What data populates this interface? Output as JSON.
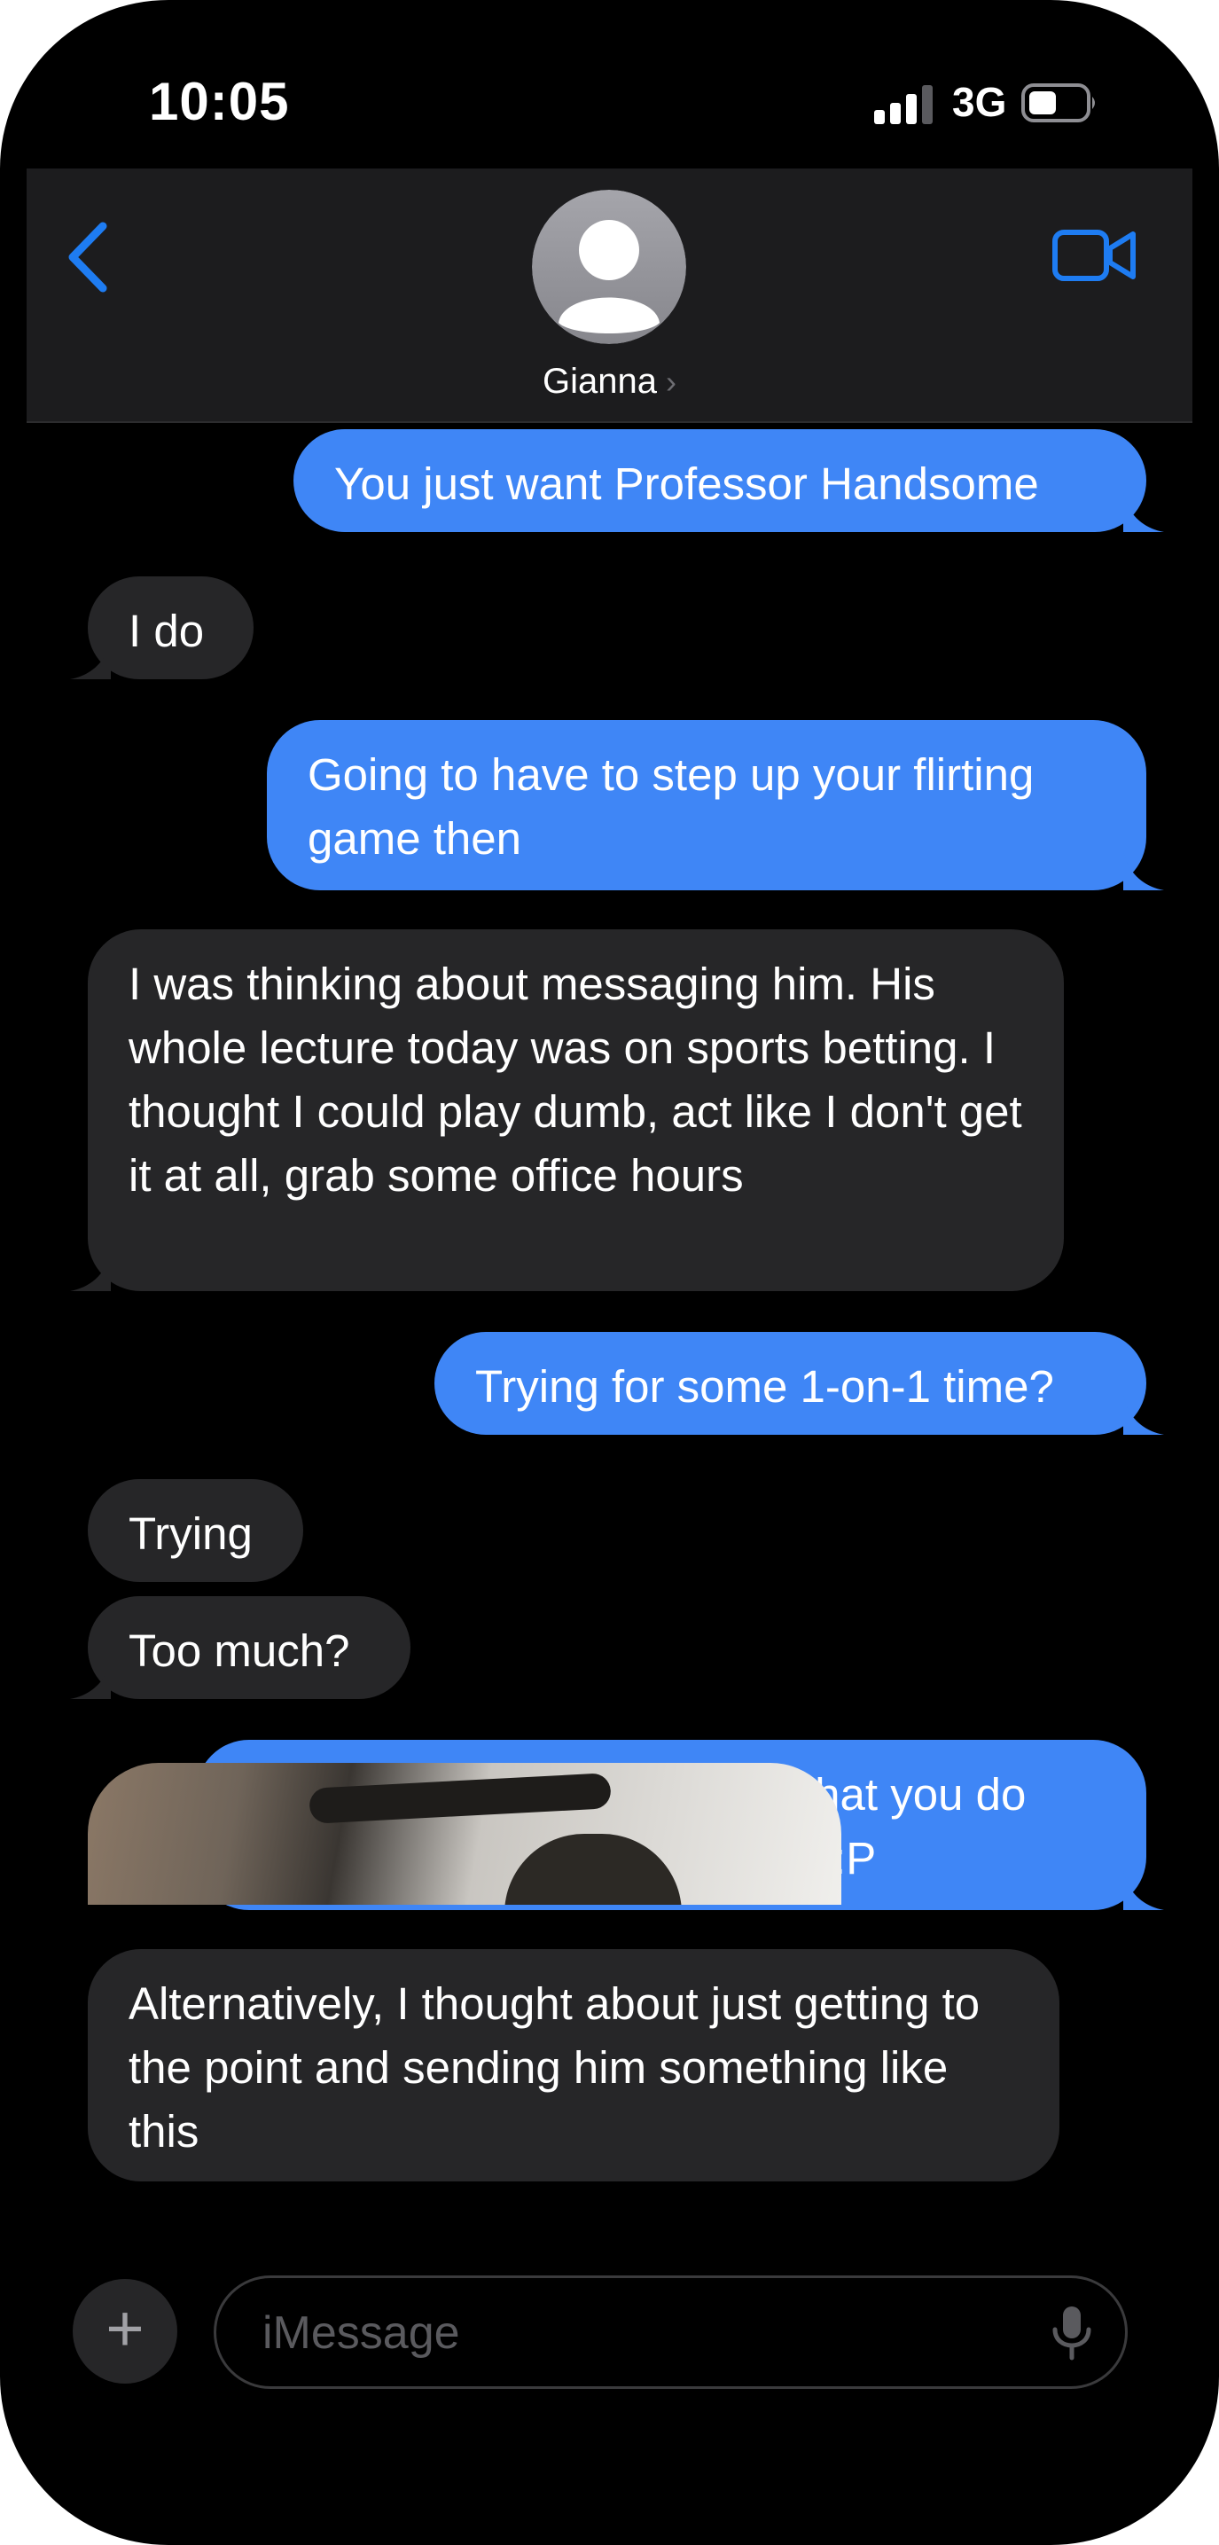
{
  "status_bar": {
    "time": "10:05",
    "network": "3G"
  },
  "header": {
    "contact_name": "Gianna"
  },
  "messages": [
    {
      "from": "me",
      "text": "You just want Professor Handsome"
    },
    {
      "from": "them",
      "text": "I do"
    },
    {
      "from": "me",
      "text": "Going to have to step up your flirting game then"
    },
    {
      "from": "them",
      "text": "I was thinking about messaging him.  His whole lecture today was on sports betting.  I thought I could play dumb, act like I don't get it at all, grab some office hours"
    },
    {
      "from": "me",
      "text": "Trying for some 1-on-1 time?"
    },
    {
      "from": "them",
      "text": "Trying"
    },
    {
      "from": "them",
      "text": "Too much?"
    },
    {
      "from": "me",
      "text": "I suppose that depends on what you do when you're in there with him :P"
    },
    {
      "from": "them",
      "text": "Alternatively, I thought about just getting to the point and sending him something like this"
    }
  ],
  "composer": {
    "placeholder": "iMessage"
  },
  "colors": {
    "outgoing": "#3f86f6",
    "incoming": "#262628",
    "accent": "#1e7cf2"
  }
}
